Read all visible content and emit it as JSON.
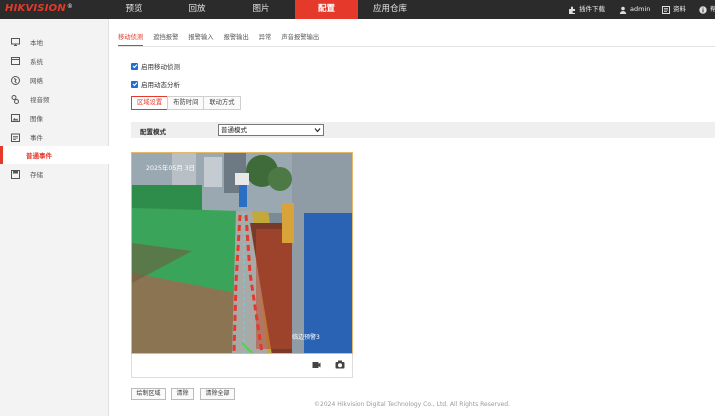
{
  "brand": {
    "name": "HIKVISION",
    "registered": "®"
  },
  "nav": [
    {
      "label": "预览",
      "active": false
    },
    {
      "label": "回放",
      "active": false
    },
    {
      "label": "图片",
      "active": false
    },
    {
      "label": "配置",
      "active": true
    },
    {
      "label": "应用仓库",
      "active": false
    }
  ],
  "topright": {
    "plugin": "插件下载",
    "user": "admin",
    "help": "资料",
    "more": "帮"
  },
  "sidebar": [
    {
      "label": "本地",
      "icon": "monitor-icon"
    },
    {
      "label": "系统",
      "icon": "system-icon"
    },
    {
      "label": "网络",
      "icon": "globe-icon"
    },
    {
      "label": "视音频",
      "icon": "camera-mic-icon"
    },
    {
      "label": "图像",
      "icon": "image-icon"
    },
    {
      "label": "事件",
      "icon": "calendar-icon"
    },
    {
      "label": "普通事件",
      "active": true
    },
    {
      "label": "存储",
      "icon": "save-icon"
    }
  ],
  "tabs": [
    "移动侦测",
    "遮挡报警",
    "报警输入",
    "报警输出",
    "异常",
    "声音报警输出"
  ],
  "checkboxes": [
    {
      "label": "启用移动侦测",
      "checked": true
    },
    {
      "label": "启用动态分析",
      "checked": true
    }
  ],
  "subtabs": [
    "区域设置",
    "布防时间",
    "联动方式"
  ],
  "config": {
    "label": "配置模式",
    "value": "普通模式"
  },
  "video": {
    "timestamp": "2025年05月 3日",
    "camera_name": "临边预警3"
  },
  "buttons": [
    "绘制区域",
    "清除",
    "清除全部"
  ],
  "footer": "©2024 Hikvision Digital Technology Co., Ltd. All Rights Reserved.",
  "colors": {
    "accent": "#e4392b",
    "topbar": "#2b2b2b",
    "checkbox": "#1f6fd1"
  }
}
